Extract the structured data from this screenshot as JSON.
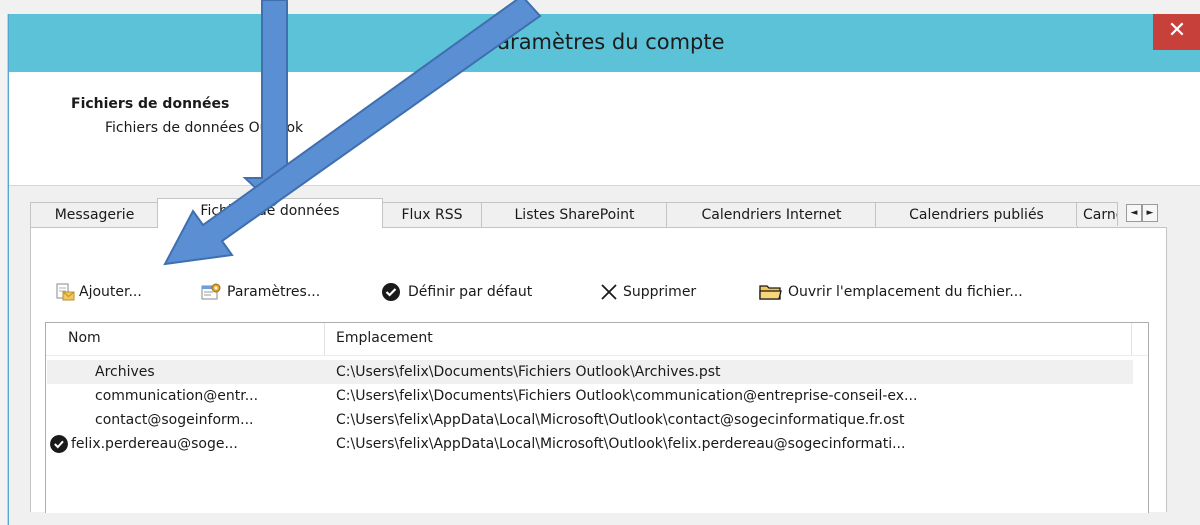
{
  "dialog": {
    "title": "Paramètres du compte",
    "close_label": "✕",
    "header_title": "Fichiers de données",
    "header_subtitle": "Fichiers de données Outlook"
  },
  "tabs": [
    {
      "label": "Messagerie",
      "active": false
    },
    {
      "label": "Fichiers de données",
      "active": true
    },
    {
      "label": "Flux RSS",
      "active": false
    },
    {
      "label": "Listes SharePoint",
      "active": false
    },
    {
      "label": "Calendriers Internet",
      "active": false
    },
    {
      "label": "Calendriers publiés",
      "active": false
    },
    {
      "label": "Carnets",
      "active": false
    }
  ],
  "tab_scroll": {
    "left": "◄",
    "right": "►"
  },
  "toolbar": {
    "add_label": "Ajouter...",
    "settings_label": "Paramètres...",
    "default_label": "Définir par défaut",
    "remove_label": "Supprimer",
    "open_location_label": "Ouvrir l'emplacement du fichier...",
    "icons": [
      "add-file-icon",
      "settings-icon",
      "check-circle-icon",
      "delete-x-icon",
      "folder-icon"
    ]
  },
  "list": {
    "columns": [
      "Nom",
      "Emplacement"
    ],
    "rows": [
      {
        "name": "Archives",
        "location": "C:\\Users\\felix\\Documents\\Fichiers Outlook\\Archives.pst",
        "default": false,
        "selected": true
      },
      {
        "name": "communication@entr...",
        "location": "C:\\Users\\felix\\Documents\\Fichiers Outlook\\communication@entreprise-conseil-ex...",
        "default": false,
        "selected": false
      },
      {
        "name": "contact@sogeinform...",
        "location": "C:\\Users\\felix\\AppData\\Local\\Microsoft\\Outlook\\contact@sogecinformatique.fr.ost",
        "default": false,
        "selected": false
      },
      {
        "name": "felix.perdereau@soge...",
        "location": "C:\\Users\\felix\\AppData\\Local\\Microsoft\\Outlook\\felix.perdereau@sogecinformati...",
        "default": true,
        "selected": false
      }
    ]
  },
  "colors": {
    "titlebar": "#5cc2d8",
    "close_button": "#c7413a",
    "annotation_arrow": "#5b8fd4"
  }
}
